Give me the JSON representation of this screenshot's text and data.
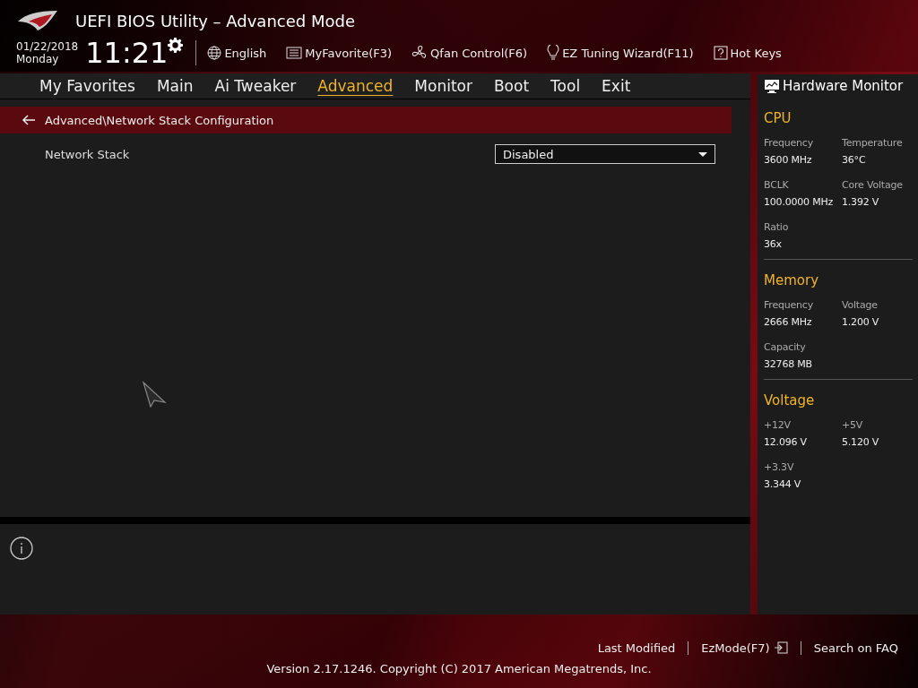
{
  "window": {
    "title": "UEFI BIOS Utility – Advanced Mode"
  },
  "header": {
    "date": "01/22/2018",
    "day": "Monday",
    "time": "11:21",
    "toolbar": [
      {
        "kind": "globe",
        "label": "English"
      },
      {
        "kind": "list",
        "label": "MyFavorite(F3)"
      },
      {
        "kind": "fan",
        "label": "Qfan Control(F6)"
      },
      {
        "kind": "bulb",
        "label": "EZ Tuning Wizard(F11)"
      },
      {
        "kind": "help",
        "label": "Hot Keys"
      }
    ]
  },
  "tabs": [
    {
      "label": "My Favorites",
      "selected": false
    },
    {
      "label": "Main",
      "selected": false
    },
    {
      "label": "Ai Tweaker",
      "selected": false
    },
    {
      "label": "Advanced",
      "selected": true
    },
    {
      "label": "Monitor",
      "selected": false
    },
    {
      "label": "Boot",
      "selected": false
    },
    {
      "label": "Tool",
      "selected": false
    },
    {
      "label": "Exit",
      "selected": false
    }
  ],
  "breadcrumb": "Advanced\\Network Stack Configuration",
  "settings": [
    {
      "label": "Network Stack",
      "value": "Disabled"
    }
  ],
  "hardware_monitor": {
    "title": "Hardware Monitor",
    "sections": [
      {
        "title": "CPU",
        "items": [
          {
            "label": "Frequency",
            "value": "3600 MHz"
          },
          {
            "label": "Temperature",
            "value": "36°C"
          },
          {
            "label": "BCLK",
            "value": "100.0000 MHz"
          },
          {
            "label": "Core Voltage",
            "value": "1.392 V"
          },
          {
            "label": "Ratio",
            "value": "36x"
          }
        ]
      },
      {
        "title": "Memory",
        "items": [
          {
            "label": "Frequency",
            "value": "2666 MHz"
          },
          {
            "label": "Voltage",
            "value": "1.200 V"
          },
          {
            "label": "Capacity",
            "value": "32768 MB"
          }
        ]
      },
      {
        "title": "Voltage",
        "items": [
          {
            "label": "+12V",
            "value": "12.096 V"
          },
          {
            "label": "+5V",
            "value": "5.120 V"
          },
          {
            "label": "+3.3V",
            "value": "3.344 V"
          }
        ]
      }
    ]
  },
  "footer": {
    "links": [
      {
        "kind": "text",
        "label": "Last Modified"
      },
      {
        "kind": "exit",
        "label": "EzMode(F7)"
      },
      {
        "kind": "text",
        "label": "Search on FAQ"
      }
    ],
    "version": "Version 2.17.1246. Copyright (C) 2017 American Megatrends, Inc."
  }
}
